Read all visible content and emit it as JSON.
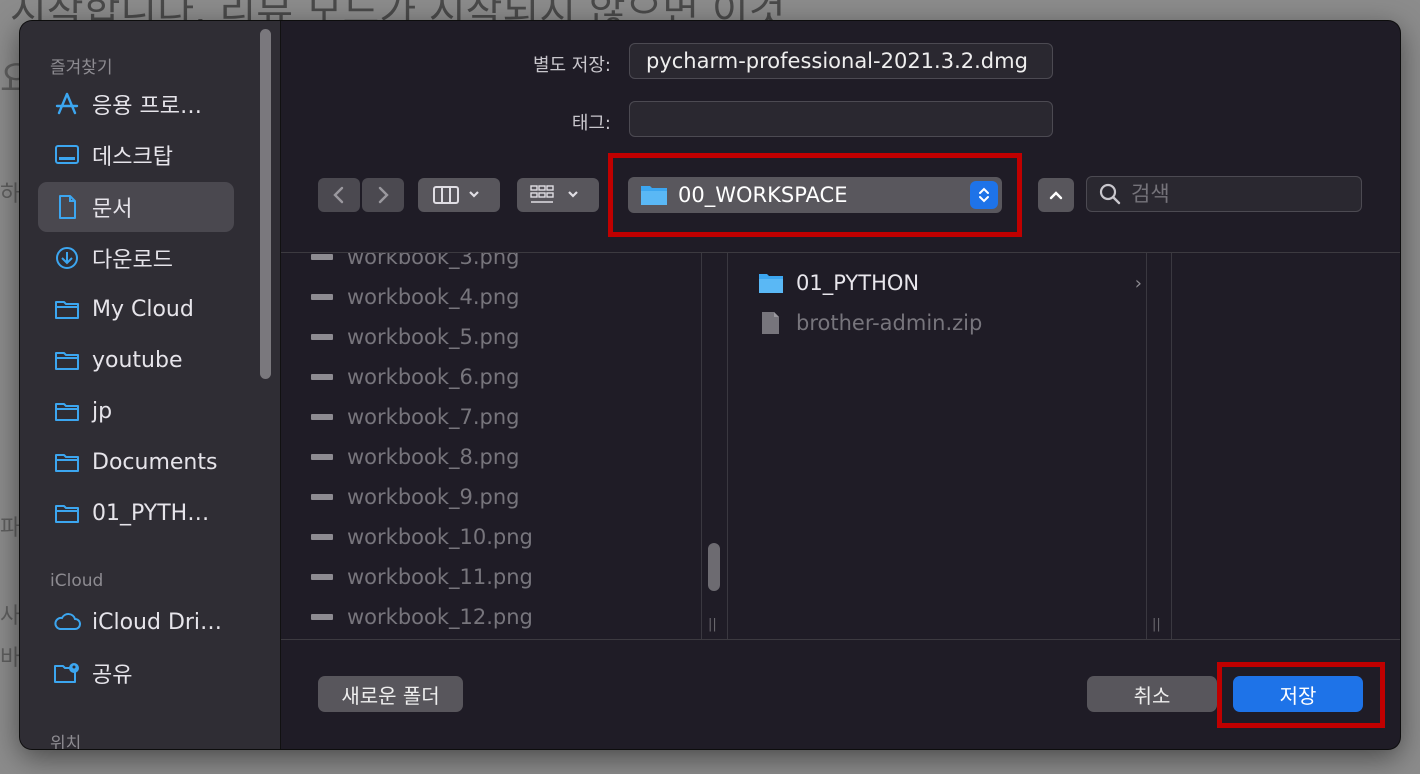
{
  "background": {
    "text_top": "시작합니다. 리뷰 모드가 시작되지 않으면 이것",
    "text_left": [
      "요",
      "하",
      "파",
      "사",
      "바"
    ]
  },
  "sidebar": {
    "favorites_header": "즐겨찾기",
    "items": [
      {
        "label": "응용 프로…",
        "icon": "applications-icon"
      },
      {
        "label": "데스크탑",
        "icon": "desktop-icon"
      },
      {
        "label": "문서",
        "icon": "document-icon",
        "selected": true
      },
      {
        "label": "다운로드",
        "icon": "download-icon"
      },
      {
        "label": "My Cloud",
        "icon": "folder-icon"
      },
      {
        "label": "youtube",
        "icon": "folder-icon"
      },
      {
        "label": "jp",
        "icon": "folder-icon"
      },
      {
        "label": "Documents",
        "icon": "folder-icon"
      },
      {
        "label": "01_PYTH…",
        "icon": "folder-icon"
      }
    ],
    "icloud_header": "iCloud",
    "icloud_items": [
      {
        "label": "iCloud Dri…",
        "icon": "cloud-icon"
      },
      {
        "label": "공유",
        "icon": "shared-folder-icon"
      }
    ],
    "locations_header": "위치"
  },
  "form": {
    "save_as_label": "별도 저장:",
    "save_as_value": "pycharm-professional-2021.3.2.dmg",
    "tags_label": "태그:",
    "tags_value": ""
  },
  "toolbar": {
    "current_folder": "00_WORKSPACE",
    "search_placeholder": "검색"
  },
  "column1_files": [
    "workbook_3.png",
    "workbook_4.png",
    "workbook_5.png",
    "workbook_6.png",
    "workbook_7.png",
    "workbook_8.png",
    "workbook_9.png",
    "workbook_10.png",
    "workbook_11.png",
    "workbook_12.png"
  ],
  "column2_items": [
    {
      "name": "01_PYTHON",
      "type": "folder"
    },
    {
      "name": "brother-admin.zip",
      "type": "file"
    }
  ],
  "footer": {
    "new_folder": "새로운 폴더",
    "cancel": "취소",
    "save": "저장"
  },
  "colors": {
    "accent": "#1e73e8",
    "highlight": "#c00000",
    "folder": "#3ca6f0"
  }
}
